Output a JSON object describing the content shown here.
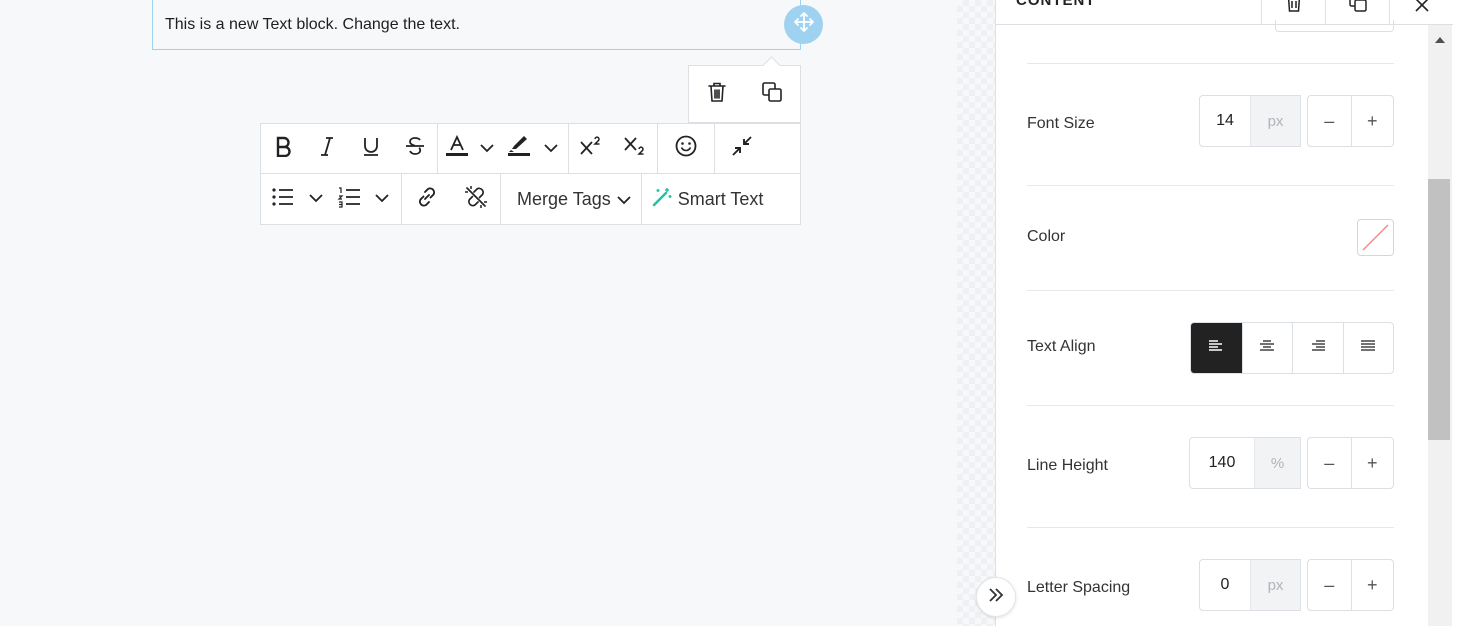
{
  "canvas": {
    "text_block_content": "This is a new Text block. Change the text."
  },
  "editor_toolbar": {
    "merge_tags_label": "Merge Tags",
    "smart_text_label": "Smart Text"
  },
  "panel": {
    "title": "CONTENT",
    "font_size": {
      "label": "Font Size",
      "value": "14",
      "unit": "px"
    },
    "color": {
      "label": "Color",
      "value": "none"
    },
    "text_align": {
      "label": "Text Align",
      "selected": "left"
    },
    "line_height": {
      "label": "Line Height",
      "value": "140",
      "unit": "%"
    },
    "letter_spacing": {
      "label": "Letter Spacing",
      "value": "0",
      "unit": "px"
    },
    "stepper_minus": "–",
    "stepper_plus": "+"
  },
  "colors": {
    "accent": "#9fd2f0",
    "selected_align": "#222222",
    "smart_text_icon": "#22c3a0"
  }
}
